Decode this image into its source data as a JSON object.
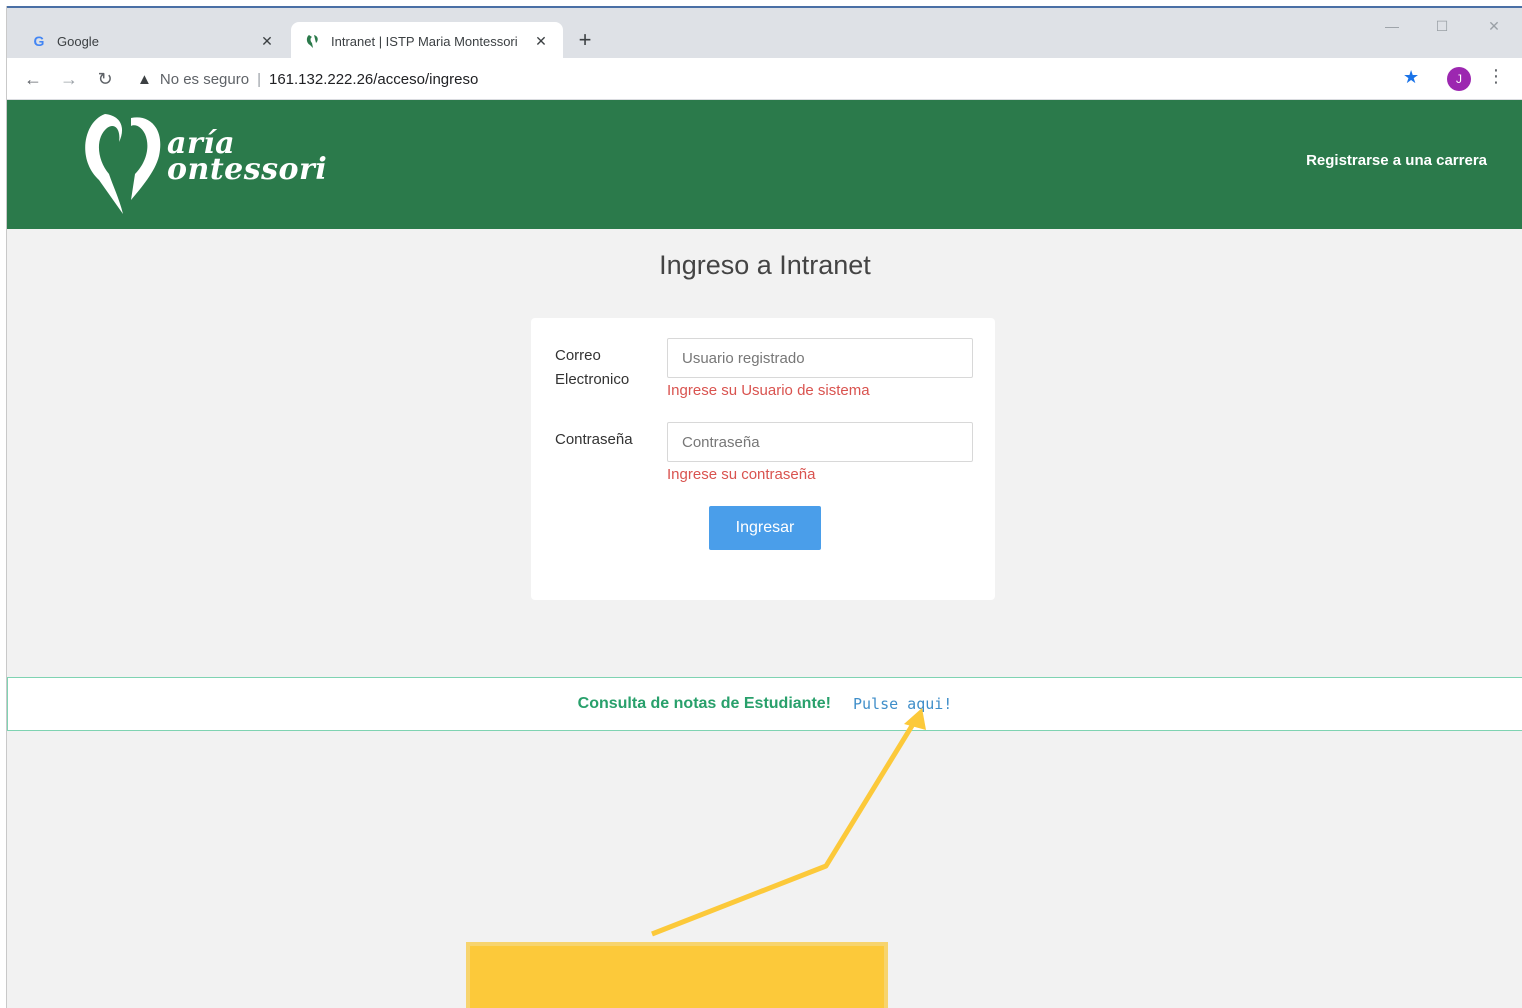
{
  "browser": {
    "tabs": [
      {
        "label": "Google",
        "favicon": "G"
      },
      {
        "label": "Intranet | ISTP Maria Montessori"
      }
    ],
    "security_label": "No es seguro",
    "url": "161.132.222.26/acceso/ingreso",
    "avatar_letter": "J"
  },
  "site": {
    "logo_line1": "aría",
    "logo_line2": "ontessori",
    "register_link": "Registrarse a una carrera"
  },
  "login": {
    "title": "Ingreso a Intranet",
    "email_label_line1": "Correo",
    "email_label_line2": "Electronico",
    "email_placeholder": "Usuario registrado",
    "email_error": "Ingrese su Usuario de sistema",
    "password_label": "Contraseña",
    "password_placeholder": "Contraseña",
    "password_error": "Ingrese su contraseña",
    "submit_label": "Ingresar"
  },
  "notice": {
    "text": "Consulta de notas de Estudiante!",
    "link": "Pulse aqui!"
  },
  "colors": {
    "header_green": "#2b7a4b",
    "button_blue": "#4a9eea",
    "error_red": "#d9534f",
    "notice_green": "#28a06b",
    "callout_yellow": "#fcc93a"
  }
}
